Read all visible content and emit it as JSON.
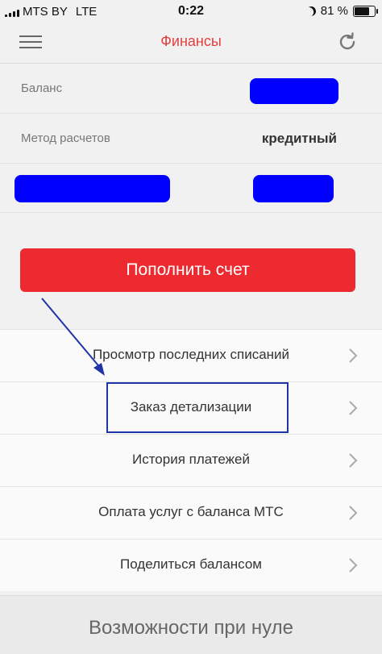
{
  "status_bar": {
    "carrier": "MTS BY",
    "network": "LTE",
    "time": "0:22",
    "battery_text": "81 %",
    "battery_level": 0.81
  },
  "nav": {
    "title": "Финансы",
    "menu_icon": "hamburger-icon",
    "refresh_icon": "refresh-icon"
  },
  "info": {
    "balance_label": "Баланс",
    "payment_method_label": "Метод расчетов",
    "payment_method_value": "кредитный"
  },
  "topup_button": "Пополнить счет",
  "menu": [
    {
      "label": "Просмотр последних списаний"
    },
    {
      "label": "Заказ детализации"
    },
    {
      "label": "История платежей"
    },
    {
      "label": "Оплата услуг с баланса МТС"
    },
    {
      "label": "Поделиться балансом"
    }
  ],
  "bottom_section": "Возможности при нуле",
  "colors": {
    "accent": "#e0403f",
    "button": "#ee2a31",
    "redaction": "#0000ff",
    "annotation": "#1e34a8"
  }
}
